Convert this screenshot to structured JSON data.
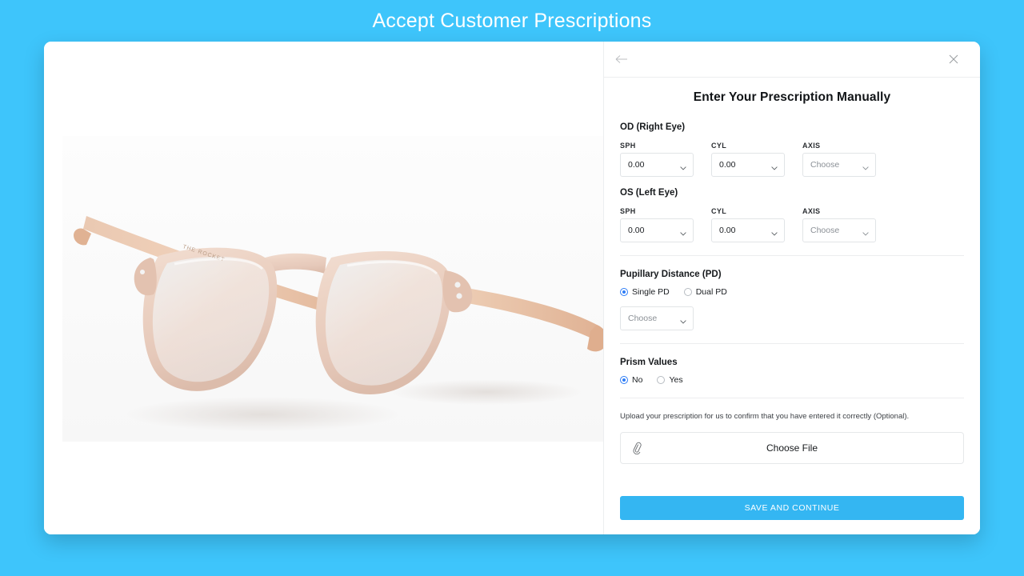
{
  "page": {
    "title": "Accept Customer Prescriptions",
    "accent_color": "#3ec5fb",
    "button_color": "#34b6f2",
    "radio_color": "#2f7df6"
  },
  "product": {
    "alt_name": "eyeglasses-blush-translucent-round-frame",
    "engraving": "THE ROCKET"
  },
  "form": {
    "topbar": {
      "back_icon": "arrow-left-icon",
      "close_icon": "close-icon"
    },
    "heading": "Enter Your Prescription Manually",
    "eyes": [
      {
        "title": "OD (Right Eye)",
        "fields": [
          {
            "label": "SPH",
            "value": "0.00",
            "placeholder": false
          },
          {
            "label": "CYL",
            "value": "0.00",
            "placeholder": false
          },
          {
            "label": "AXIS",
            "value": "Choose",
            "placeholder": true
          }
        ]
      },
      {
        "title": "OS (Left Eye)",
        "fields": [
          {
            "label": "SPH",
            "value": "0.00",
            "placeholder": false
          },
          {
            "label": "CYL",
            "value": "0.00",
            "placeholder": false
          },
          {
            "label": "AXIS",
            "value": "Choose",
            "placeholder": true
          }
        ]
      }
    ],
    "pd": {
      "title": "Pupillary Distance (PD)",
      "options": [
        {
          "label": "Single PD",
          "checked": true
        },
        {
          "label": "Dual PD",
          "checked": false
        }
      ],
      "select_value": "Choose",
      "select_placeholder": true
    },
    "prism": {
      "title": "Prism Values",
      "options": [
        {
          "label": "No",
          "checked": true
        },
        {
          "label": "Yes",
          "checked": false
        }
      ]
    },
    "upload": {
      "note": "Upload your prescription for us to confirm that you have entered it correctly (Optional).",
      "button_label": "Choose File",
      "icon": "paperclip-icon"
    },
    "submit_label": "SAVE AND CONTINUE"
  }
}
